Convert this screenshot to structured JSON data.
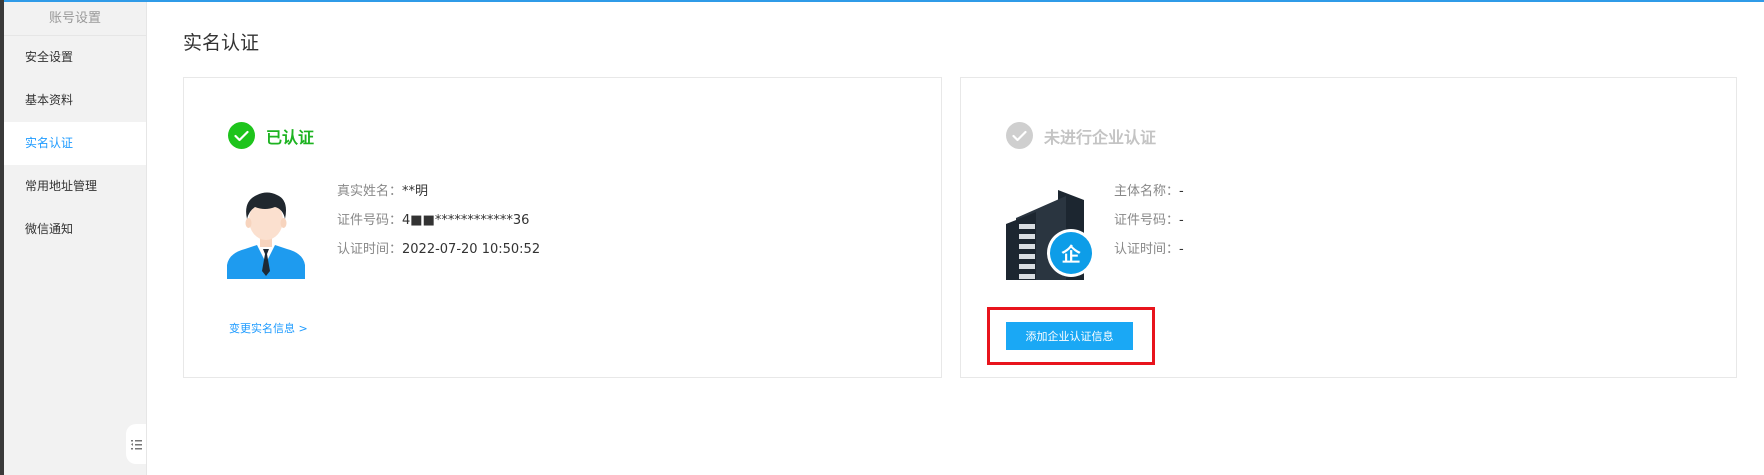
{
  "sidebar": {
    "title": "账号设置",
    "items": [
      {
        "label": "安全设置"
      },
      {
        "label": "基本资料"
      },
      {
        "label": "实名认证"
      },
      {
        "label": "常用地址管理"
      },
      {
        "label": "微信通知"
      }
    ],
    "active_index": 2
  },
  "page": {
    "title": "实名认证"
  },
  "personal": {
    "status": "已认证",
    "fields": [
      {
        "label": "真实姓名：",
        "value": "**明"
      },
      {
        "label": "证件号码：",
        "value": "4■■************36"
      },
      {
        "label": "认证时间：",
        "value": "2022-07-20 10:50:52"
      }
    ],
    "change_link": "变更实名信息 >"
  },
  "enterprise": {
    "status": "未进行企业认证",
    "badge_char": "企",
    "fields": [
      {
        "label": "主体名称：",
        "value": "-"
      },
      {
        "label": "证件号码：",
        "value": "-"
      },
      {
        "label": "认证时间：",
        "value": "-"
      }
    ],
    "add_button": "添加企业认证信息"
  },
  "icons": {
    "verified": "check-circle-icon",
    "pending": "check-circle-icon",
    "avatar": "person-avatar-icon",
    "building": "enterprise-building-icon",
    "collapse": "list-collapse-icon"
  },
  "colors": {
    "accent": "#1e9bff",
    "success": "#1ec41c",
    "highlight": "#e8141c",
    "button": "#1aa8f5"
  }
}
